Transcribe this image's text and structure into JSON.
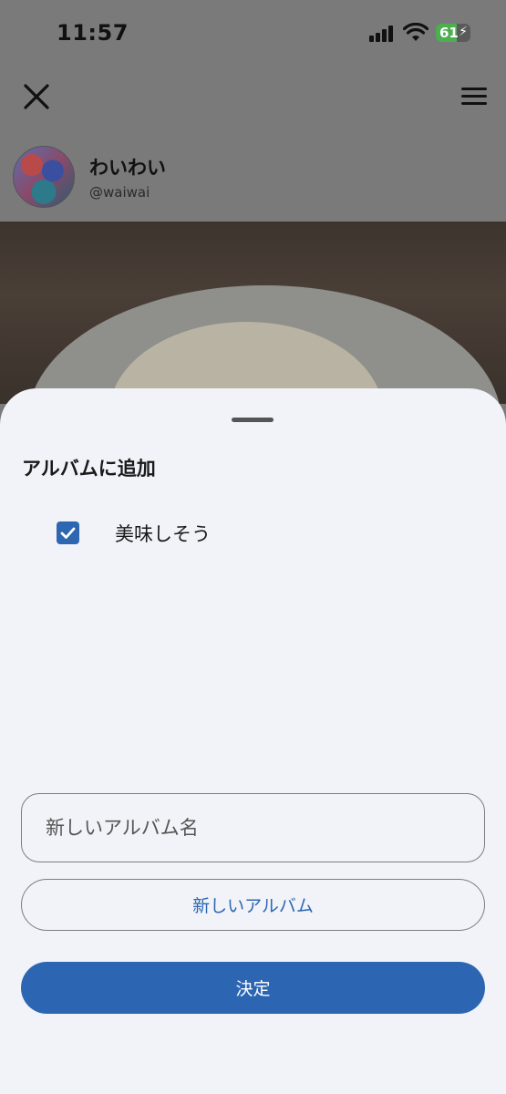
{
  "status_bar": {
    "time": "11:57",
    "battery_level": "61",
    "battery_charging": true
  },
  "app_bar": {
    "close_icon": "close-icon",
    "menu_icon": "hamburger-menu-icon"
  },
  "profile": {
    "display_name": "わいわい",
    "username": "@waiwai"
  },
  "sheet": {
    "title": "アルバムに追加",
    "albums": [
      {
        "label": "美味しそう",
        "checked": true
      }
    ],
    "new_album_name": {
      "placeholder": "新しいアルバム名",
      "value": ""
    },
    "new_album_button": "新しいアルバム",
    "confirm_button": "決定"
  },
  "colors": {
    "accent": "#2c66b2",
    "sheet_background": "#f1f3f8",
    "battery_green": "#4caf50"
  }
}
